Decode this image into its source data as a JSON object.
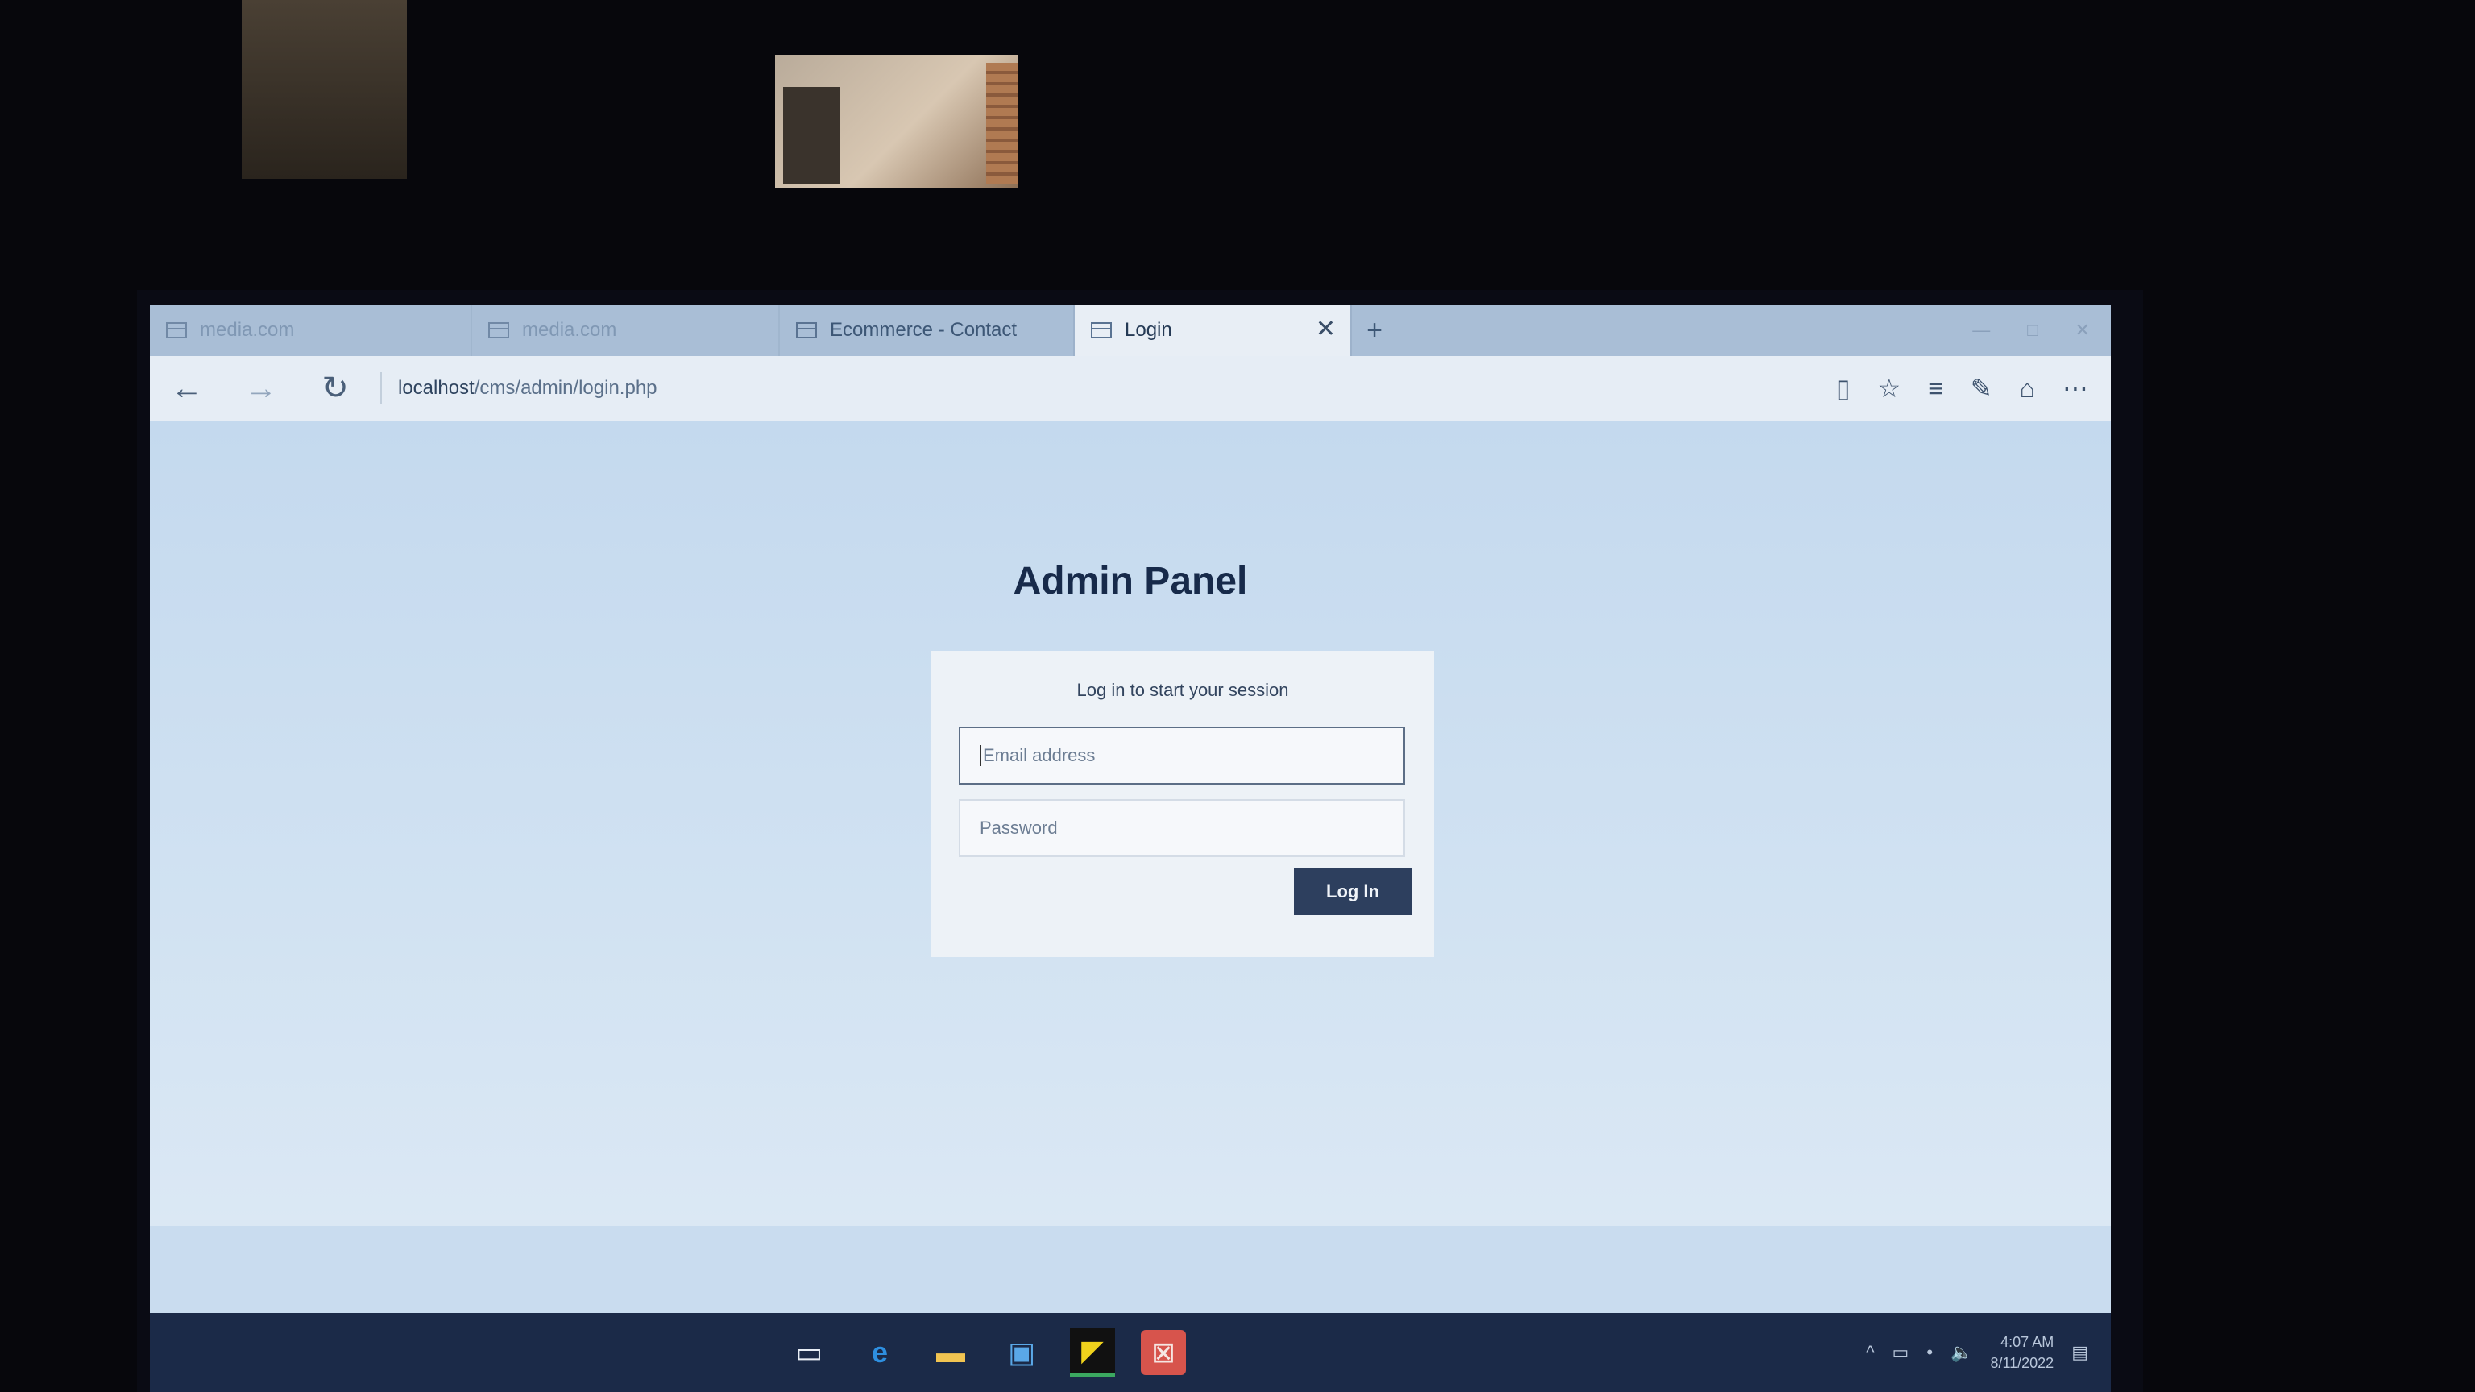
{
  "browser": {
    "tabs": [
      {
        "label": "media.com",
        "state": "faded"
      },
      {
        "label": "media.com",
        "state": "faded"
      },
      {
        "label": "Ecommerce - Contact",
        "state": "normal"
      },
      {
        "label": "Login",
        "state": "active"
      }
    ],
    "new_tab_label": "+",
    "close_label": "✕",
    "url": {
      "host": "localhost",
      "path": "/cms/admin/login.php"
    }
  },
  "page": {
    "title": "Admin Panel",
    "message": "Log in to start your session",
    "email_placeholder": "Email address",
    "password_placeholder": "Password",
    "login_button": "Log In"
  },
  "taskbar": {
    "time": "4:07 AM",
    "date": "8/11/2022"
  },
  "colors": {
    "page_background": "#c9dcef",
    "button": "#2d3f5e",
    "taskbar": "#1b2a48"
  }
}
